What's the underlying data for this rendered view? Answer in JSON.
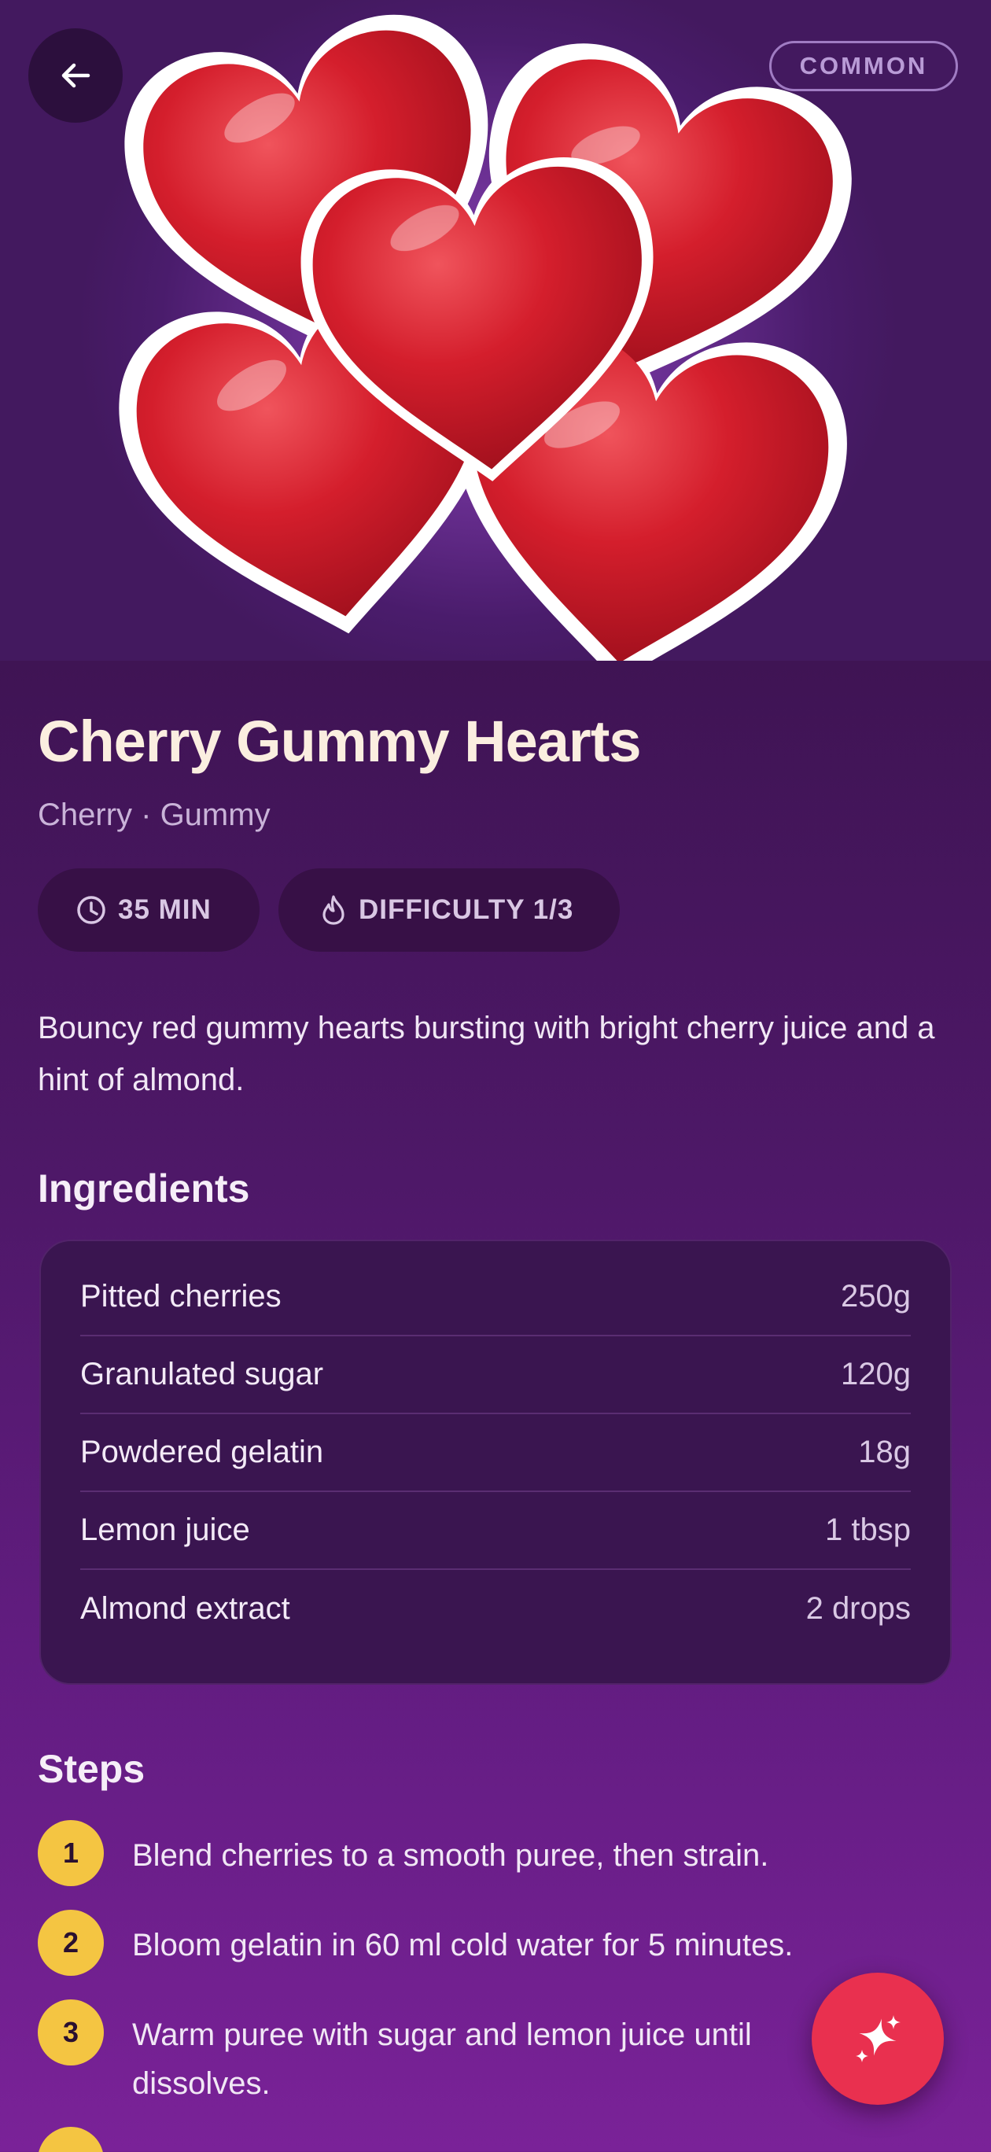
{
  "header": {
    "back_icon": "arrow-left-icon",
    "rarity_badge": "COMMON"
  },
  "recipe": {
    "title": "Cherry Gummy Hearts",
    "subtitle": "Cherry · Gummy",
    "time_chip": {
      "icon": "clock-icon",
      "label": "35 MIN"
    },
    "difficulty_chip": {
      "icon": "flame-icon",
      "label": "DIFFICULTY 1/3"
    },
    "description": "Bouncy red gummy hearts bursting with bright cherry juice and a hint of almond."
  },
  "ingredients": {
    "heading": "Ingredients",
    "items": [
      {
        "name": "Pitted cherries",
        "amount": "250g"
      },
      {
        "name": "Granulated sugar",
        "amount": "120g"
      },
      {
        "name": "Powdered gelatin",
        "amount": "18g"
      },
      {
        "name": "Lemon juice",
        "amount": "1 tbsp"
      },
      {
        "name": "Almond extract",
        "amount": "2 drops"
      }
    ]
  },
  "steps": {
    "heading": "Steps",
    "items": [
      {
        "number": "1",
        "text": "Blend cherries to a smooth puree, then strain."
      },
      {
        "number": "2",
        "text": "Bloom gelatin in 60 ml cold water for 5 minutes."
      },
      {
        "number": "3",
        "text": "Warm puree with sugar and lemon juice until dissolves."
      }
    ]
  },
  "fab": {
    "icon": "sparkle-icon"
  },
  "colors": {
    "accent_yellow": "#f4c542",
    "fab_red": "#e9304f",
    "background": "#3f1454",
    "heart_red": "#d6222f"
  }
}
